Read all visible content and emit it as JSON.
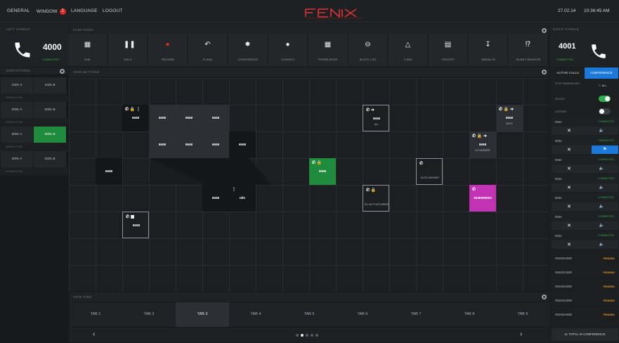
{
  "menu": {
    "general": "GENERAL",
    "window": "WINDOW",
    "window_badge": "2",
    "language": "LANGUAGE",
    "logout": "LOGOUT"
  },
  "datetime": {
    "date": "27.02.14",
    "time": "10:36:45 AM"
  },
  "left_handle": {
    "label": "LEFT HANDLE",
    "number": "4000",
    "status": "CONNECTED"
  },
  "functions": {
    "label": "FUNCTIONS",
    "buttons": [
      {
        "label": "DIAL",
        "icon": "dialpad-icon"
      },
      {
        "label": "HOLD",
        "icon": "pause-icon"
      },
      {
        "label": "RECORD",
        "icon": "record-icon"
      },
      {
        "label": "R-DIAL",
        "icon": "redial-icon"
      },
      {
        "label": "CONFERENCE",
        "icon": "conference-icon"
      },
      {
        "label": "CONSULT",
        "icon": "consult-icon"
      },
      {
        "label": "PHONE BOOK",
        "icon": "phonebook-icon"
      },
      {
        "label": "BLOCK LIST",
        "icon": "block-icon"
      },
      {
        "label": "3 WAY",
        "icon": "three-way-icon"
      },
      {
        "label": "HISTORY",
        "icon": "history-icon"
      },
      {
        "label": "BREAK IN",
        "icon": "break-in-icon"
      },
      {
        "label": "SILENT MONITOR",
        "icon": "ear-icon"
      }
    ]
  },
  "right_handle": {
    "label": "RIGHT HANDLE",
    "number": "4001",
    "status": "CONNECTED"
  },
  "dispatchers": {
    "label": "DISPATCHERS",
    "rows": [
      {
        "a": "1001 A",
        "b": "1001 B",
        "sub": "MARIAN STAN"
      },
      {
        "a": "2001 A",
        "b": "2001 B",
        "sub": "MARIAN STAN"
      },
      {
        "a": "3001 A",
        "b": "3001 B",
        "sub": "MARIAN STAN"
      },
      {
        "a": "4001 A",
        "b": "4001 B",
        "sub": "MARIAN STAN"
      }
    ]
  },
  "grid": {
    "label": "GRID BUTTONS",
    "cells": [
      {
        "num": "6658",
        "extra": ""
      },
      {
        "num": "6658",
        "extra": ""
      },
      {
        "num": "6658",
        "extra": ""
      },
      {
        "num": "6658",
        "extra": ""
      },
      {
        "num": "6658",
        "extra": "ALL"
      },
      {
        "num": "6658",
        "extra": "BUSY"
      },
      {
        "num": "6658",
        "extra": ""
      },
      {
        "num": "6658",
        "extra": ""
      },
      {
        "num": "6658",
        "extra": ""
      },
      {
        "num": "6658",
        "extra": ""
      },
      {
        "num": "6658",
        "extra": "NO ANSWER"
      },
      {
        "num": "6658",
        "extra": ""
      },
      {
        "num": "6658",
        "extra": ""
      },
      {
        "num": "",
        "extra": "AUTO ANSWER"
      },
      {
        "num": "6658",
        "extra": ""
      },
      {
        "num": "Idle",
        "extra": ""
      },
      {
        "num": "",
        "extra": "DO NOT DISTURBED"
      },
      {
        "num": "0545008053",
        "extra": ""
      },
      {
        "num": "6658",
        "extra": ""
      }
    ]
  },
  "grid_tabs": {
    "label": "GRID TABS",
    "tabs": [
      "TAB 1",
      "TAB 2",
      "TAB 3",
      "TAB 4",
      "TAB 5",
      "TAB 6",
      "TAB 7",
      "TAB 8",
      "TAB 9"
    ],
    "active_index": 2,
    "pages": 5,
    "active_page": 1
  },
  "right_panel": {
    "tab_active_calls": "ACTIVE CALLS",
    "tab_conference": "CONFERENCE",
    "stop_sharing": "STOP SHARING 4001",
    "all": "ALL",
    "sticky": "STICKY",
    "locked": "LOCKED",
    "conference": [
      {
        "name": "6554",
        "status": "CONNECTED"
      },
      {
        "name": "6554",
        "status": "CONNECTED"
      },
      {
        "name": "6554",
        "status": "CONNECTED"
      },
      {
        "name": "6554",
        "status": "CONNECTED"
      },
      {
        "name": "6554",
        "status": "CONNECTED"
      },
      {
        "name": "6554",
        "status": "CONNECTED"
      },
      {
        "name": "6554",
        "status": "CONNECTED"
      }
    ],
    "pending": [
      {
        "name": "0554524688",
        "status": "PENDING"
      },
      {
        "name": "0554524688",
        "status": "PENDING"
      },
      {
        "name": "0554524688",
        "status": "PENDING"
      },
      {
        "name": "0554524688",
        "status": "PENDING"
      },
      {
        "name": "0554524688",
        "status": "PENDING"
      }
    ],
    "total": "11 TOTAL IN CONFERENCE"
  },
  "colors": {
    "accent": "#1b79d9",
    "green": "#1e8c3c",
    "magenta": "#c233b3",
    "pending": "#e0962a"
  }
}
